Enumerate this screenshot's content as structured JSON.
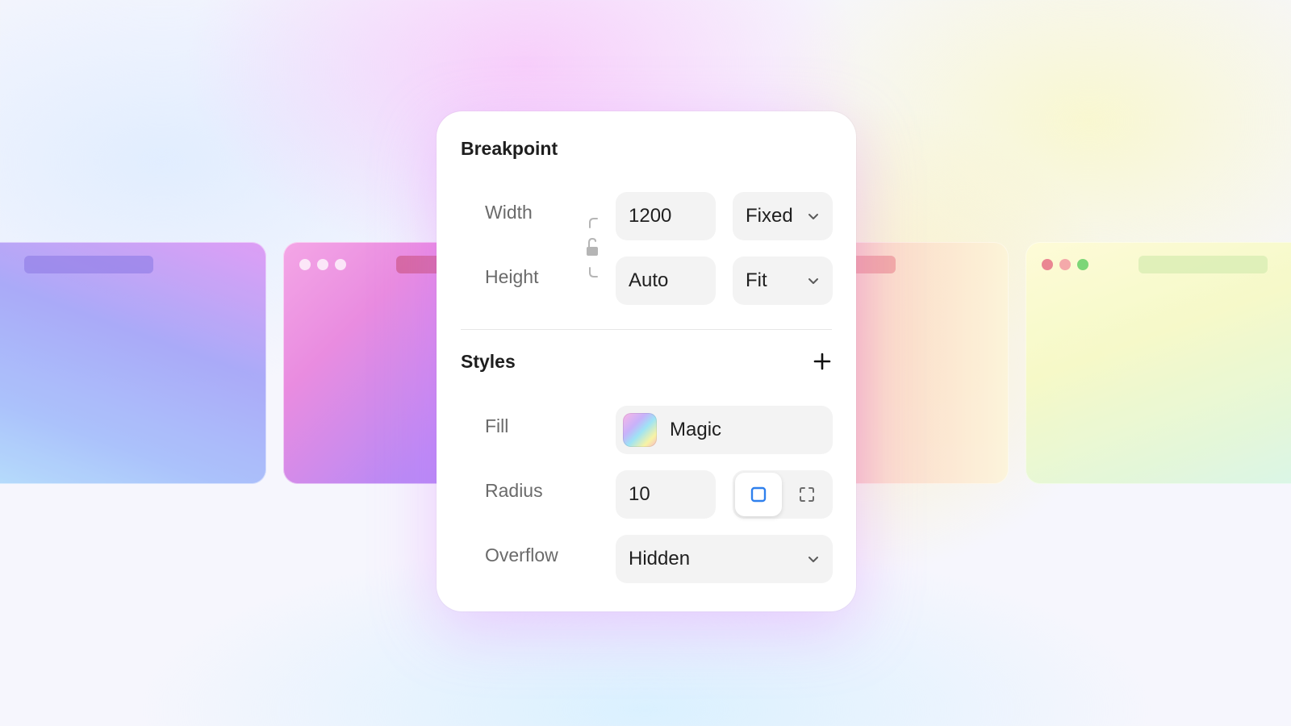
{
  "breakpoint": {
    "title": "Breakpoint",
    "width_label": "Width",
    "width_value": "1200",
    "width_mode": "Fixed",
    "height_label": "Height",
    "height_value": "Auto",
    "height_mode": "Fit",
    "aspect_lock": "unlocked"
  },
  "styles": {
    "title": "Styles",
    "add_icon": "plus-icon",
    "fill_label": "Fill",
    "fill_value": "Magic",
    "radius_label": "Radius",
    "radius_value": "10",
    "radius_mode_selected": "uniform",
    "overflow_label": "Overflow",
    "overflow_value": "Hidden"
  },
  "colors": {
    "accent": "#2f80ed",
    "panel_background": "#ffffff",
    "field_background": "#f3f3f3"
  }
}
